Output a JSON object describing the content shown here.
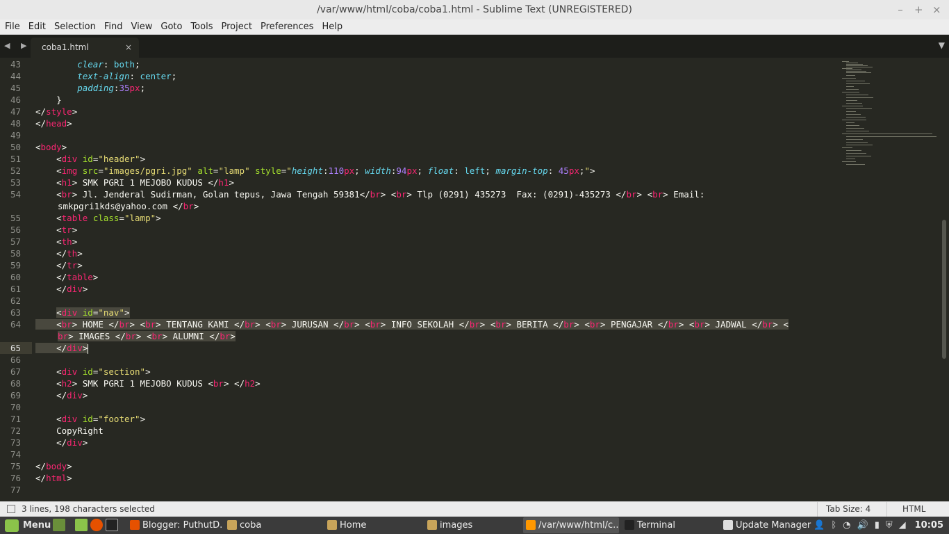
{
  "window": {
    "title": "/var/www/html/coba/coba1.html - Sublime Text (UNREGISTERED)",
    "controls": {
      "minimize": "–",
      "maximize": "+",
      "close": "×"
    }
  },
  "menu": [
    "File",
    "Edit",
    "Selection",
    "Find",
    "View",
    "Goto",
    "Tools",
    "Project",
    "Preferences",
    "Help"
  ],
  "tabs": {
    "nav_arrows": "◀ ▶",
    "active_tab": "coba1.html",
    "close_glyph": "×",
    "dropdown_glyph": "▼"
  },
  "editor": {
    "current_line": 65,
    "lines": [
      {
        "n": "43"
      },
      {
        "n": "44"
      },
      {
        "n": "45"
      },
      {
        "n": "46"
      },
      {
        "n": "47"
      },
      {
        "n": "48"
      },
      {
        "n": "49"
      },
      {
        "n": "50",
        "fold": "▼"
      },
      {
        "n": "51"
      },
      {
        "n": "52"
      },
      {
        "n": "53"
      },
      {
        "n": "54"
      },
      {
        "n": ""
      },
      {
        "n": "55"
      },
      {
        "n": "56"
      },
      {
        "n": "57"
      },
      {
        "n": "58"
      },
      {
        "n": "59"
      },
      {
        "n": "60"
      },
      {
        "n": "61"
      },
      {
        "n": "62"
      },
      {
        "n": "63"
      },
      {
        "n": "64"
      },
      {
        "n": ""
      },
      {
        "n": "65"
      },
      {
        "n": "66"
      },
      {
        "n": "67"
      },
      {
        "n": "68"
      },
      {
        "n": "69"
      },
      {
        "n": "70"
      },
      {
        "n": "71"
      },
      {
        "n": "72"
      },
      {
        "n": "73"
      },
      {
        "n": "74"
      },
      {
        "n": "75"
      },
      {
        "n": "76"
      },
      {
        "n": "77"
      }
    ],
    "code": {
      "l43": "        clear: both;",
      "l44": "        text-align: center;",
      "l45": "        padding:35px;",
      "l46": "    }",
      "l47": "</style>",
      "l48": "</head>",
      "l50": "<body>",
      "l51": "    <div id=\"header\">",
      "l52": "    <img src=\"images/pgri.jpg\" alt=\"lamp\" style=\"height:110px; width:94px; float: left; margin-top: 45px;\">",
      "l53": "    <h1> SMK PGRI 1 MEJOBO KUDUS </h1>",
      "l54a": "    <br> Jl. Jenderal Sudirman, Golan tepus, Jawa Tengah 59381</br> <br> Tlp (0291) 435273  Fax: (0291)-435273 </br> <br> Email:",
      "l54b": "smkpgri1kds@yahoo.com </br>",
      "l55": "    <table class=\"lamp\">",
      "l56": "    <tr>",
      "l57": "    <th>",
      "l58": "    </th>",
      "l59": "    </tr>",
      "l60": "    </table>",
      "l61": "    </div>",
      "l63": "    <div id=\"nav\">",
      "l64a": "    <br> HOME </br> <br> TENTANG KAMI </br> <br> JURUSAN </br> <br> INFO SEKOLAH </br> <br> BERITA </br> <br> PENGAJAR </br> <br> JADWAL </br> <",
      "l64b": "br> IMAGES </br> <br> ALUMNI </br>",
      "l65": "    </div>",
      "l67": "    <div id=\"section\">",
      "l68": "    <h2> SMK PGRI 1 MEJOBO KUDUS <br> </h2>",
      "l69": "    </div>",
      "l71": "    <div id=\"footer\">",
      "l72": "    CopyRight",
      "l73": "    </div>",
      "l75": "</body>",
      "l76": "</html>"
    }
  },
  "status": {
    "selection": "3 lines, 198 characters selected",
    "tab_size": "Tab Size: 4",
    "syntax": "HTML"
  },
  "taskbar": {
    "menu_label": "Menu",
    "tasks": [
      {
        "label": "Blogger: PuthutD...",
        "icon_color": "#e65100"
      },
      {
        "label": "coba",
        "icon_color": "#c8a45a"
      },
      {
        "label": "Home",
        "icon_color": "#c8a45a"
      },
      {
        "label": "images",
        "icon_color": "#c8a45a"
      },
      {
        "label": "/var/www/html/c...",
        "icon_color": "#ff9800"
      },
      {
        "label": "Terminal",
        "icon_color": "#222222"
      },
      {
        "label": "Update Manager",
        "icon_color": "#dddddd"
      }
    ],
    "clock": "10:05"
  },
  "colors": {
    "editor_bg": "#272822",
    "tag": "#f92672",
    "attr": "#a6e22e",
    "string": "#e6db74",
    "css_property": "#66d9ef",
    "number": "#ae81ff",
    "selection": "#49483e"
  }
}
